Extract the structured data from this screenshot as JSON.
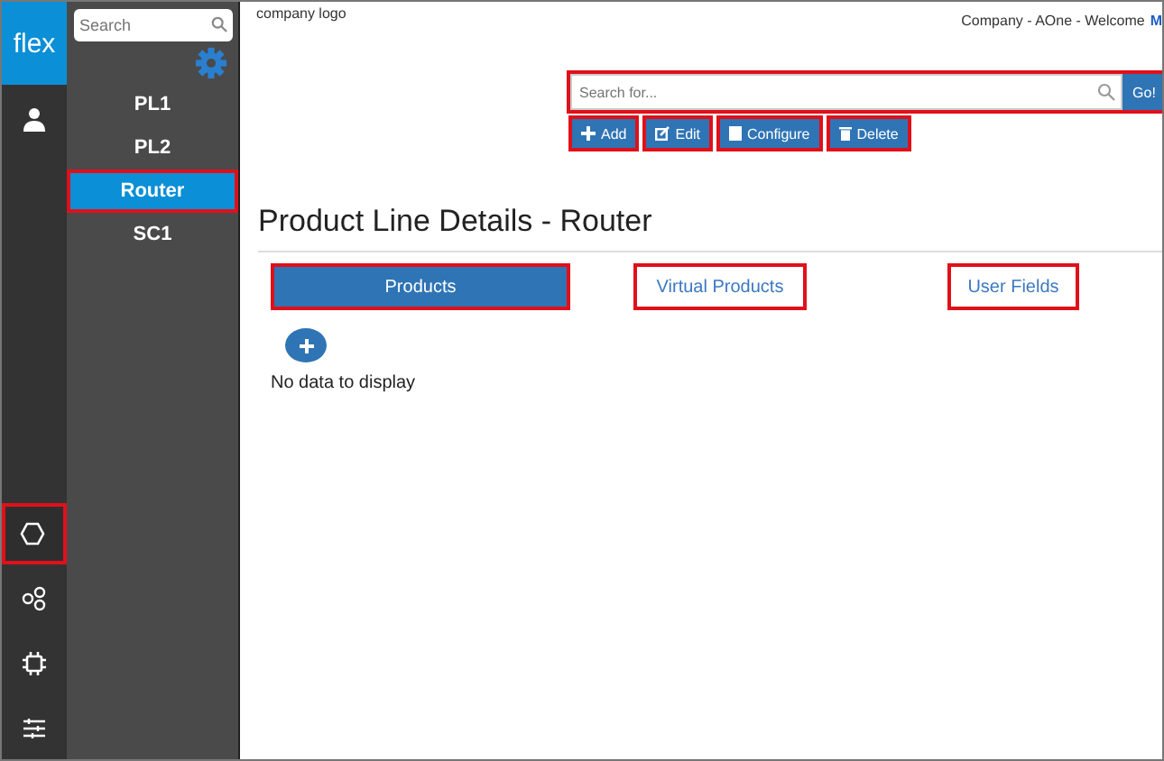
{
  "rail": {
    "logo": "flex",
    "top_items": [
      {
        "kind": "user",
        "selected": false,
        "highlighted": false
      }
    ],
    "bottom_items": [
      {
        "kind": "hexagon",
        "selected": true,
        "highlighted": true
      },
      {
        "kind": "circles",
        "selected": false,
        "highlighted": false
      },
      {
        "kind": "chip",
        "selected": false,
        "highlighted": false
      },
      {
        "kind": "sliders",
        "selected": false,
        "highlighted": false
      }
    ]
  },
  "sidebar": {
    "search": {
      "placeholder": "Search"
    },
    "items": [
      {
        "label": "PL1",
        "selected": false,
        "highlighted": false
      },
      {
        "label": "PL2",
        "selected": false,
        "highlighted": false
      },
      {
        "label": "Router",
        "selected": true,
        "highlighted": true
      },
      {
        "label": "SC1",
        "selected": false,
        "highlighted": false
      }
    ]
  },
  "header": {
    "logo": "company logo",
    "info": "Company - AOne - Welcome",
    "user": "M"
  },
  "search": {
    "placeholder": "Search for...",
    "button": "Go!",
    "highlighted": true
  },
  "actions": [
    {
      "kind": "add",
      "label": "Add",
      "highlighted": true
    },
    {
      "kind": "edit",
      "label": "Edit",
      "highlighted": true
    },
    {
      "kind": "configure",
      "label": "Configure",
      "highlighted": true
    },
    {
      "kind": "delete",
      "label": "Delete",
      "highlighted": true
    }
  ],
  "title": "Product Line Details - Router",
  "tabs": [
    {
      "label": "Products",
      "selected": true,
      "highlighted": true
    },
    {
      "label": "Virtual Products",
      "selected": false,
      "highlighted": true
    },
    {
      "label": "User Fields",
      "selected": false,
      "highlighted": true
    }
  ],
  "empty_message": "No data to display"
}
